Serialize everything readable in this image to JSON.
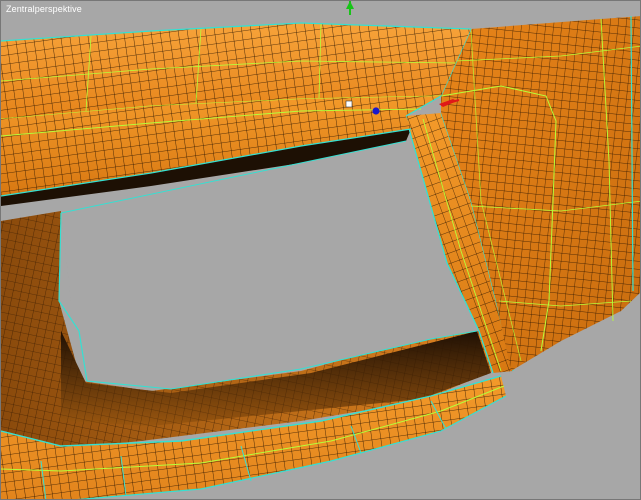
{
  "viewport": {
    "label": "Zentralperspektive",
    "colors": {
      "background": "#a7a7a7",
      "surface": "#f0901f",
      "surface_light": "#f6a43a",
      "surface_dark": "#b8600c",
      "wire": "#1a0c00",
      "isoline": "#b6ff3a",
      "edge": "#35e0d2",
      "shadow": "#231305"
    },
    "gizmo": {
      "y_axis_color": "#18c418",
      "x_axis_color": "#e01818",
      "z_axis_color": "#1a1acc",
      "origin_color": "#ffffff"
    }
  }
}
